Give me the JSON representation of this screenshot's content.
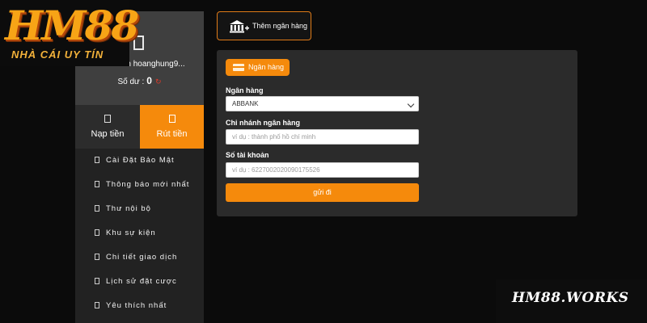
{
  "logo": {
    "mark": "HM88",
    "tagline": "NHÀ CÁI UY TÍN"
  },
  "profile": {
    "account": "Tài Khoản hoanghung9...",
    "balance_label": "Số dư :",
    "balance_value": "0",
    "refresh_glyph": "↻"
  },
  "tabs": {
    "deposit": "Nạp tiền",
    "withdraw": "Rút tiền"
  },
  "menu": {
    "items": [
      {
        "label": "Cài Đặt Bảo Mật"
      },
      {
        "label": "Thông báo mới nhất"
      },
      {
        "label": "Thư nội bộ"
      },
      {
        "label": "Khu sự kiện"
      },
      {
        "label": "Chi tiết giao dịch"
      },
      {
        "label": "Lịch sử đặt cược"
      },
      {
        "label": "Yêu thích nhất"
      }
    ]
  },
  "add_bank": {
    "label": "Thêm ngân hàng",
    "icon": "bank-add-icon"
  },
  "form": {
    "tab_label": "Ngân hàng",
    "bank_label": "Ngân hàng",
    "bank_value": "ABBANK",
    "branch_label": "Chi nhánh ngân hàng",
    "branch_placeholder": "ví dụ : thành phố hồ chí minh",
    "account_label": "Số tài khoản",
    "account_placeholder": "ví dụ : 6227002020090175526",
    "submit_label": "gửi đi"
  },
  "watermark": {
    "text": "HM88.WORKS"
  },
  "colors": {
    "accent": "#f58a0c",
    "panel": "#2b2b2b",
    "sidebar": "#222222",
    "background": "#0b0b0b"
  }
}
